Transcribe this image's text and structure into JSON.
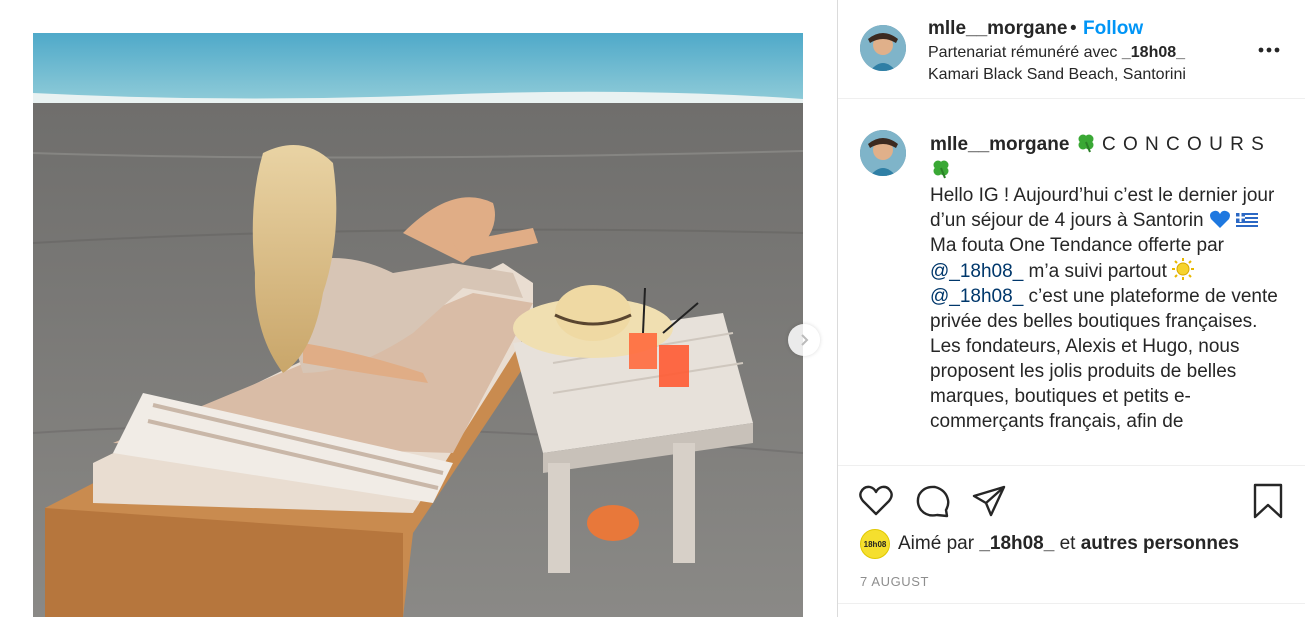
{
  "post": {
    "username": "mlle__morgane",
    "dot": "•",
    "follow_label": "Follow",
    "partnership_prefix": "Partenariat rémunéré avec ",
    "partner_name": "_18h08_",
    "location": "Kamari Black Sand Beach, Santorini",
    "more_icon": "more-horizontal-icon"
  },
  "caption": {
    "username": "mlle__morgane",
    "title": "C O N C O U R S",
    "line_hello": "Hello IG ! Aujourd’hui c’est le dernier jour d’un séjour de 4 jours à Santorin",
    "line_fouta": "Ma fouta One Tendance offerte par",
    "mention_1": "@_18h08_",
    "line_suivi": "m’a suivi partout",
    "mention_2": "@_18h08_",
    "line_rest": "c’est une plateforme de vente privée des belles boutiques françaises. Les fondateurs, Alexis et Hugo, nous proposent les jolis produits de belles marques, boutiques et petits e-commerçants français, afin de",
    "emojis": [
      "clover-emoji",
      "clover-emoji",
      "blue-heart-emoji",
      "greece-flag-emoji",
      "sun-emoji"
    ]
  },
  "actions": {
    "icons": [
      "heart-icon",
      "comment-icon",
      "share-icon",
      "bookmark-icon"
    ],
    "liked_avatar_text": "18h08",
    "liked_prefix": "Aimé par ",
    "liked_user": "_18h08_",
    "liked_middle": " et ",
    "liked_others": "autres personnes",
    "date": "7 AUGUST"
  },
  "colors": {
    "follow_blue": "#0095f6",
    "text": "#262626",
    "secondary": "#8e8e8e",
    "border": "#dbdbdb"
  }
}
